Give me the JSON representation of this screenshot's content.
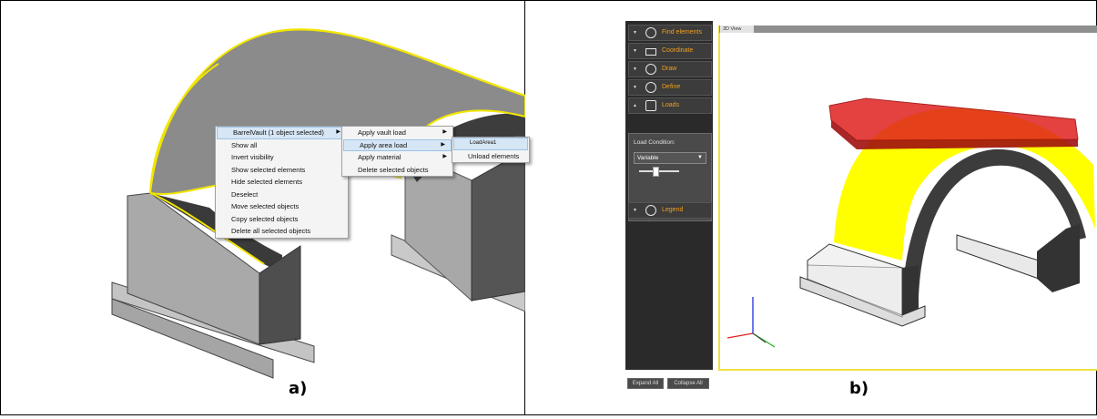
{
  "captions": {
    "a": "a)",
    "b": "b)"
  },
  "panel_a": {
    "context_menu": {
      "items": [
        {
          "label": "BarrelVault (1 object selected)",
          "submenu": true,
          "highlighted": true
        },
        {
          "label": "Show all"
        },
        {
          "label": "Invert visibility"
        },
        {
          "label": "Show selected elements"
        },
        {
          "label": "Hide selected elements"
        },
        {
          "label": "Deselect"
        },
        {
          "label": "Move selected objects"
        },
        {
          "label": "Copy selected objects"
        },
        {
          "label": "Delete all selected objects"
        }
      ]
    },
    "submenu_1": {
      "items": [
        {
          "label": "Apply vault load",
          "submenu": true
        },
        {
          "label": "Apply area load",
          "submenu": true,
          "highlighted": true
        },
        {
          "label": "Apply material",
          "submenu": true
        },
        {
          "label": "Delete selected objects"
        }
      ]
    },
    "submenu_2": {
      "items": [
        {
          "label": "LoadArea1",
          "highlighted": true
        },
        {
          "label": "Unload elements"
        }
      ]
    },
    "colors": {
      "selection_outline": "#f2e600",
      "vault": "#8a8a8a"
    }
  },
  "panel_b": {
    "sidebar": {
      "sections": [
        {
          "label": "Find elements",
          "icon": "search-icon"
        },
        {
          "label": "Coordinate",
          "icon": "coordinate-icon"
        },
        {
          "label": "Draw",
          "icon": "draw-icon"
        },
        {
          "label": "Define",
          "icon": "define-icon"
        },
        {
          "label": "Loads",
          "icon": "loads-icon",
          "expanded": true
        },
        {
          "label": "Legend",
          "icon": "legend-icon"
        }
      ],
      "load_condition_label": "Load Condition:",
      "load_condition_value": "Variable",
      "expand_all": "Expand All",
      "collapse_all": "Collapse All"
    },
    "view_tab": "3D View",
    "colors": {
      "accent": "#f0a020",
      "load_slab": "#e01010",
      "vault_fill": "#ffff00",
      "vault_edge": "#3a3a3a"
    }
  }
}
